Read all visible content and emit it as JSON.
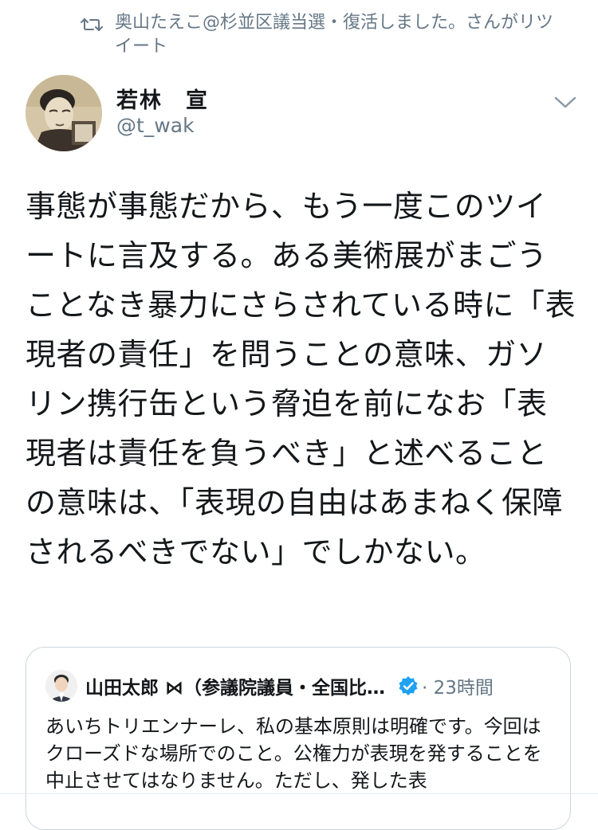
{
  "retweet": {
    "icon": "retweet-icon",
    "text": "奥山たえこ@杉並区議当選・復活しました。さんがリツイート"
  },
  "author": {
    "name": "若林　宣",
    "handle": "@t_wak",
    "avatar_icon": "avatar",
    "more_icon": "chevron-down-icon"
  },
  "tweet": {
    "text": "事態が事態だから、もう一度このツイートに言及する。ある美術展がまごうことなき暴力にさらされている時に「表現者の責任」を問うことの意味、ガソリン携行缶という脅迫を前になお「表現者は責任を負うべき」と述べることの意味は、「表現の自由はあまねく保障されるべきでない」でしかない。"
  },
  "quoted_tweet": {
    "name": "山田太郎 ⋈（参議院議員・全国比…",
    "verified_icon": "verified-badge-icon",
    "verified_color": "#1da1f2",
    "time": "· 23時間",
    "text": "あいちトリエンナーレ、私の基本原則は明確です。今回はクローズドな場所でのこと。公権力が表現を発することを中止させてはなりません。ただし、発した表"
  },
  "colors": {
    "text": "#14171a",
    "secondary": "#657786",
    "border": "#ccd6dd"
  }
}
